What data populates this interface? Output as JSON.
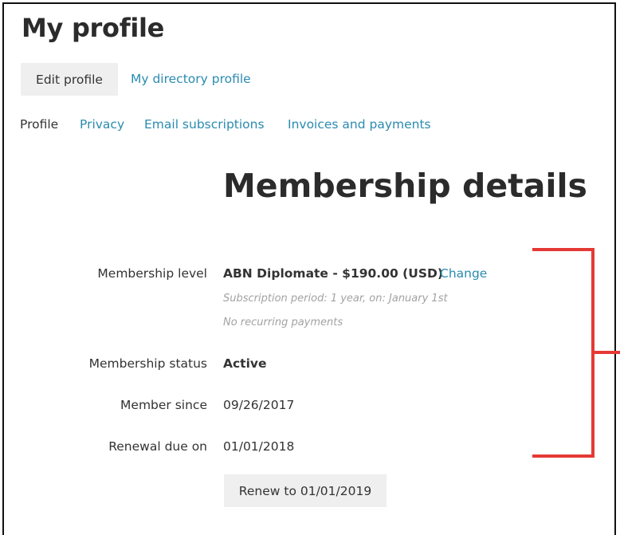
{
  "header": {
    "title": "My profile"
  },
  "actions": {
    "edit_profile": "Edit profile",
    "directory_profile": "My directory profile"
  },
  "tabs": [
    {
      "label": "Profile",
      "active": true
    },
    {
      "label": "Privacy",
      "active": false
    },
    {
      "label": "Email subscriptions",
      "active": false
    },
    {
      "label": "Invoices and payments",
      "active": false
    }
  ],
  "membership": {
    "title": "Membership details",
    "level_label": "Membership level",
    "level_value": "ABN Diplomate - $190.00 (USD)",
    "change_link": "Change",
    "subscription_note": "Subscription period: 1 year, on: January 1st",
    "recurring_note": "No recurring payments",
    "status_label": "Membership status",
    "status_value": "Active",
    "since_label": "Member since",
    "since_value": "09/26/2017",
    "renewal_label": "Renewal due on",
    "renewal_value": "01/01/2018",
    "renew_button": "Renew to 01/01/2019"
  },
  "colors": {
    "link": "#2a8bb0",
    "text": "#333333",
    "button_bg": "#efefef",
    "annotation": "#e53935"
  }
}
